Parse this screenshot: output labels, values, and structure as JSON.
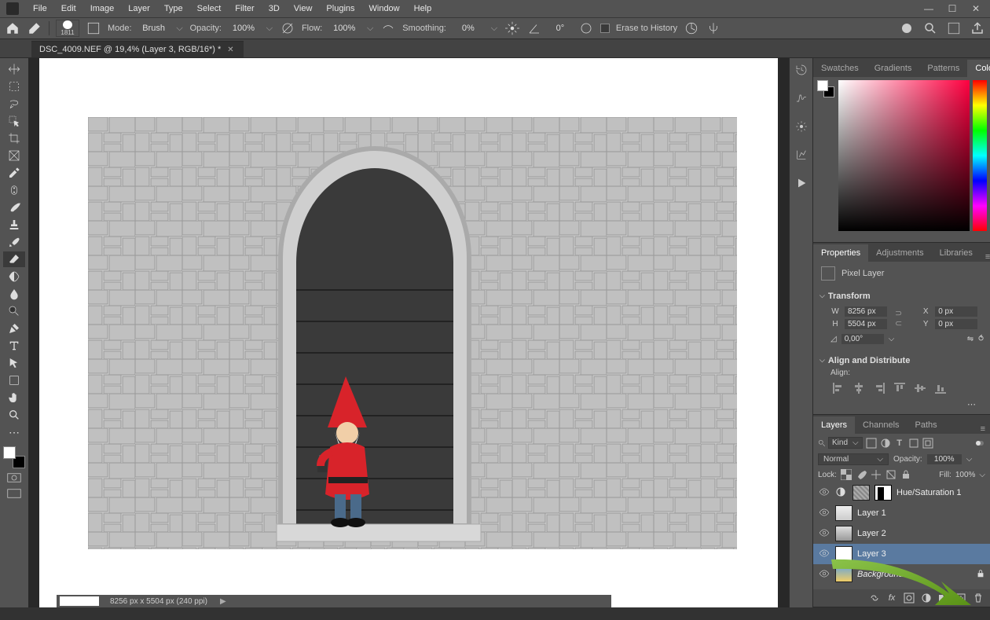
{
  "menu": {
    "items": [
      "File",
      "Edit",
      "Image",
      "Layer",
      "Type",
      "Select",
      "Filter",
      "3D",
      "View",
      "Plugins",
      "Window",
      "Help"
    ]
  },
  "options": {
    "brush_size": "1811",
    "mode_label": "Mode:",
    "mode_value": "Brush",
    "opacity_label": "Opacity:",
    "opacity_value": "100%",
    "flow_label": "Flow:",
    "flow_value": "100%",
    "smoothing_label": "Smoothing:",
    "smoothing_value": "0%",
    "angle_value": "0°",
    "erase_history": "Erase to History"
  },
  "tab": {
    "title": "DSC_4009.NEF @ 19,4% (Layer 3, RGB/16*) *"
  },
  "status": {
    "dims": "8256 px x 5504 px (240 ppi)"
  },
  "color_tabs": [
    "Swatches",
    "Gradients",
    "Patterns",
    "Color"
  ],
  "props_tabs": [
    "Properties",
    "Adjustments",
    "Libraries"
  ],
  "props": {
    "kind": "Pixel Layer",
    "transform": "Transform",
    "W": "8256 px",
    "H": "5504 px",
    "X": "0 px",
    "Y": "0 px",
    "angle": "0,00°",
    "align_hdr": "Align and Distribute",
    "align_lbl": "Align:"
  },
  "layers_tabs": [
    "Layers",
    "Channels",
    "Paths"
  ],
  "layers": {
    "kind": "Kind",
    "blend": "Normal",
    "opacity_label": "Opacity:",
    "opacity": "100%",
    "lock_label": "Lock:",
    "fill_label": "Fill:",
    "fill": "100%",
    "items": [
      {
        "name": "Hue/Saturation 1",
        "type": "adj"
      },
      {
        "name": "Layer 1",
        "type": "img1"
      },
      {
        "name": "Layer 2",
        "type": "img2"
      },
      {
        "name": "Layer 3",
        "type": "white",
        "selected": true
      },
      {
        "name": "Background",
        "type": "img3",
        "locked": true,
        "italic": true
      }
    ]
  }
}
